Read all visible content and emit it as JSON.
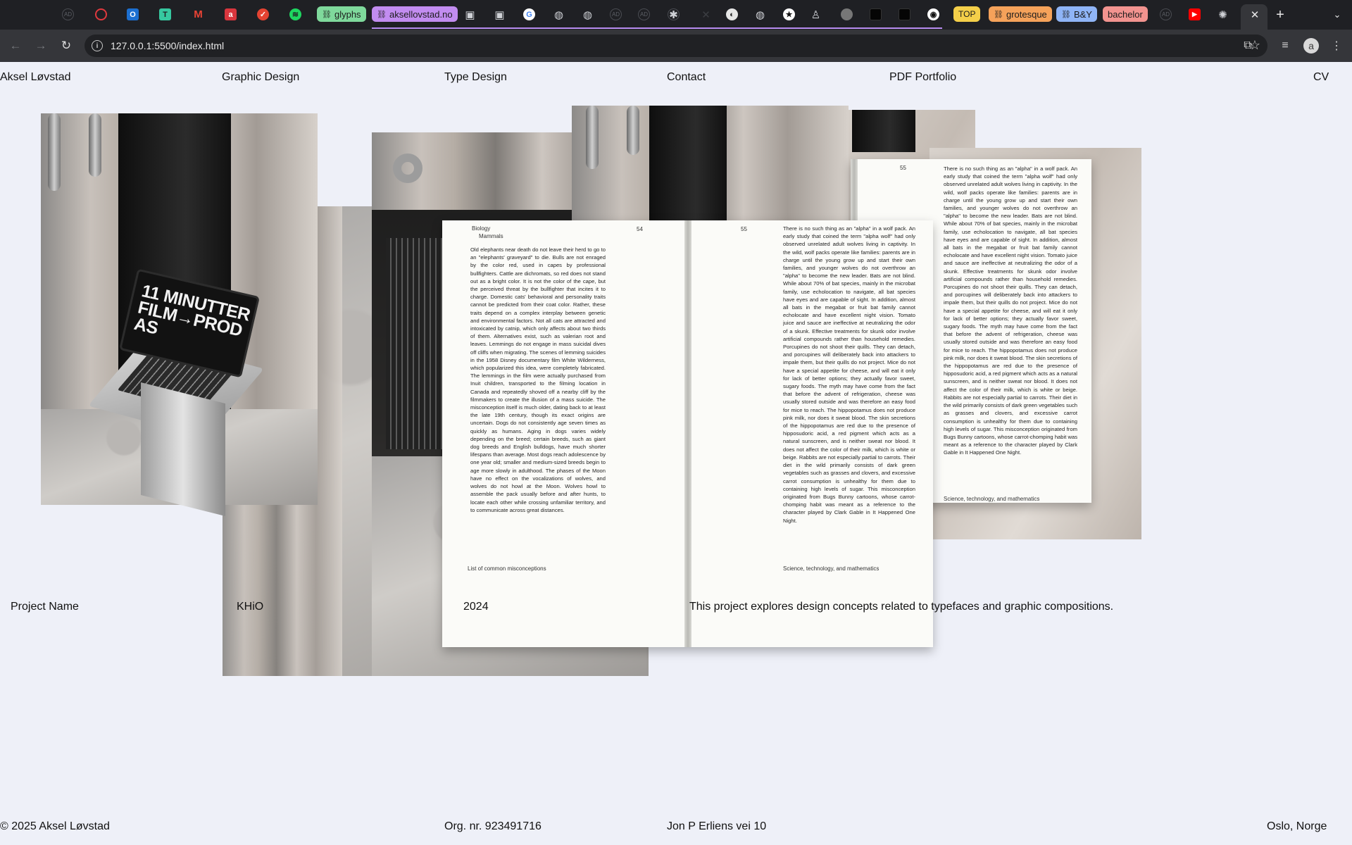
{
  "browser": {
    "tabs": {
      "glyphs": "glyphs",
      "aksellovstad": "aksellovstad.no",
      "top": "TOP",
      "grotesque": "grotesque",
      "by": "B&Y",
      "bachelor": "bachelor"
    },
    "url": "127.0.0.1:5500/index.html",
    "avatar_letter": "a"
  },
  "nav": {
    "brand": "Aksel Løvstad",
    "graphic_design": "Graphic Design",
    "type_design": "Type Design",
    "contact": "Contact",
    "pdf_portfolio": "PDF Portfolio",
    "cv": "CV"
  },
  "gallery": {
    "laptop_screen_text": "11 MINUTTER FILM→PROD AS",
    "book": {
      "left_page_number": "54",
      "right_page_number": "55",
      "running_head_1": "Biology",
      "running_head_2": "Mammals",
      "left_text": "Old elephants near death do not leave their herd to go to an \"elephants' graveyard\" to die. Bulls are not enraged by the color red, used in capes by professional bullfighters. Cattle are dichromats, so red does not stand out as a bright color. It is not the color of the cape, but the perceived threat by the bullfighter that incites it to charge. Domestic cats' behavioral and personality traits cannot be predicted from their coat color. Rather, these traits depend on a complex interplay between genetic and environmental factors. Not all cats are attracted and intoxicated by catnip, which only affects about two thirds of them. Alternatives exist, such as valerian root and leaves. Lemmings do not engage in mass suicidal dives off cliffs when migrating. The scenes of lemming suicides in the 1958 Disney documentary film White Wilderness, which popularized this idea, were completely fabricated. The lemmings in the film were actually purchased from Inuit children, transported to the filming location in Canada and repeatedly shoved off a nearby cliff by the filmmakers to create the illusion of a mass suicide. The misconception itself is much older, dating back to at least the late 19th century, though its exact origins are uncertain. Dogs do not consistently age seven times as quickly as humans. Aging in dogs varies widely depending on the breed; certain breeds, such as giant dog breeds and English bulldogs, have much shorter lifespans than average. Most dogs reach adolescence by one year old; smaller and medium-sized breeds begin to age more slowly in adulthood. The phases of the Moon have no effect on the vocalizations of wolves, and wolves do not howl at the Moon. Wolves howl to assemble the pack usually before and after hunts, to locate each other while crossing unfamiliar territory, and to communicate across great distances.",
      "left_footer": "List of common misconceptions",
      "right_text": "There is no such thing as an \"alpha\" in a wolf pack. An early study that coined the term \"alpha wolf\" had only observed unrelated adult wolves living in captivity. In the wild, wolf packs operate like families: parents are in charge until the young grow up and start their own families, and younger wolves do not overthrow an \"alpha\" to become the new leader. Bats are not blind. While about 70% of bat species, mainly in the microbat family, use echolocation to navigate, all bat species have eyes and are capable of sight. In addition, almost all bats in the megabat or fruit bat family cannot echolocate and have excellent night vision. Tomato juice and sauce are ineffective at neutralizing the odor of a skunk. Effective treatments for skunk odor involve artificial compounds rather than household remedies. Porcupines do not shoot their quills. They can detach, and porcupines will deliberately back into attackers to impale them, but their quills do not project. Mice do not have a special appetite for cheese, and will eat it only for lack of better options; they actually favor sweet, sugary foods. The myth may have come from the fact that before the advent of refrigeration, cheese was usually stored outside and was therefore an easy food for mice to reach. The hippopotamus does not produce pink milk, nor does it sweat blood. The skin secretions of the hippopotamus are red due to the presence of hipposudoric acid, a red pigment which acts as a natural sunscreen, and is neither sweat nor blood. It does not affect the color of their milk, which is white or beige. Rabbits are not especially partial to carrots. Their diet in the wild primarily consists of dark green vegetables such as grasses and clovers, and excessive carrot consumption is unhealthy for them due to containing high levels of sugar. This misconception originated from Bugs Bunny cartoons, whose carrot-chomping habit was meant as a reference to the character played by Clark Gable in It Happened One Night.",
      "right_footer": "Science, technology, and mathematics"
    }
  },
  "caption": {
    "project_name": "Project Name",
    "client": "KHiO",
    "year": "2024",
    "description": "This project explores design concepts related to typefaces and graphic compositions."
  },
  "footer": {
    "copyright": "© 2025 Aksel Løvstad",
    "org": "Org. nr. 923491716",
    "address": "Jon P Erliens vei 10",
    "city": "Oslo, Norge"
  }
}
